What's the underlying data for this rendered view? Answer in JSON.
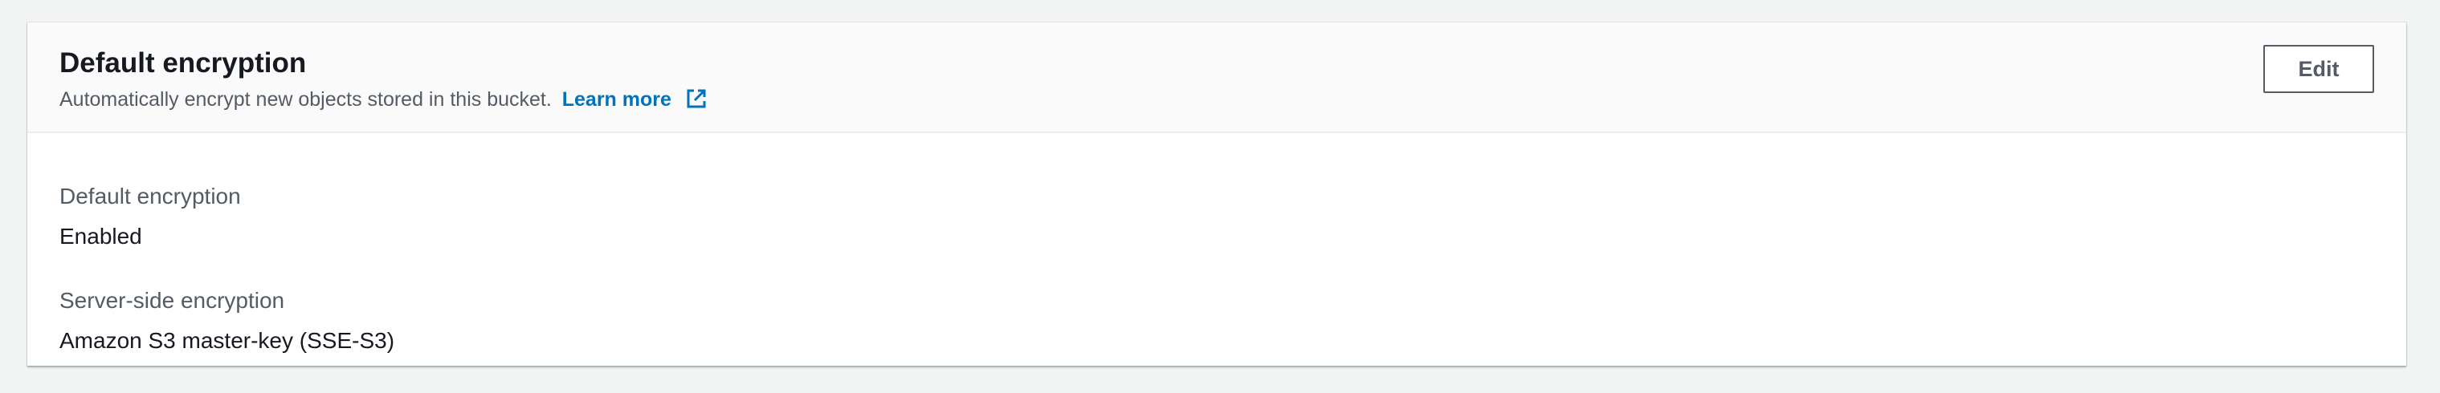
{
  "panel": {
    "title": "Default encryption",
    "description": "Automatically encrypt new objects stored in this bucket.",
    "learn_more_label": "Learn more",
    "edit_label": "Edit",
    "learn_more_icon": "external-link-icon"
  },
  "fields": [
    {
      "label": "Default encryption",
      "value": "Enabled"
    },
    {
      "label": "Server-side encryption",
      "value": "Amazon S3 master-key (SSE-S3)"
    }
  ],
  "colors": {
    "page_background": "#f2f3f3",
    "header_background": "#fafafa",
    "link": "#0073bb",
    "label_text": "#545b64",
    "value_text": "#16191f"
  }
}
